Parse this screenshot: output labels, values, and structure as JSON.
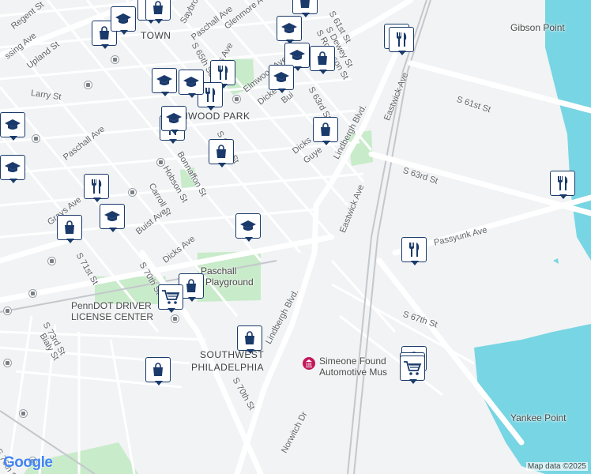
{
  "map": {
    "colors": {
      "background": "#f1f3f4",
      "water": "#78d5e3",
      "park": "#c8ebc9",
      "road": "#ffffff",
      "rail": "#c4c7cc",
      "marker": "#1a3a6b",
      "poi": "#c2185b"
    },
    "neighborhoods": [
      "TOWN",
      "ELMWOOD PARK",
      "SOUTHWEST",
      "PHILADELPHIA"
    ],
    "places": [
      "Gibson Point",
      "Yankee Point",
      "Paschall",
      "Playground",
      "PennDOT DRIVER",
      "LICENSE CENTER",
      "Simeone Found",
      "Automotive Mus"
    ],
    "streets": [
      "Regent St",
      "Saybrook",
      "Paschall Ave",
      "Glenmore Ave",
      "S 61st St",
      "S Dewey St",
      "S Robinson St",
      "ssing Ave",
      "Upland St",
      "Grays Ave",
      "S 65th St",
      "Larry St",
      "Elmwood Ave",
      "Dicke",
      "Bui",
      "S 63rd St",
      "Lindbergh Blvd.",
      "Eastwick Ave",
      "S 61st St",
      "Paschall Ave",
      "S 66th St",
      "Dicks",
      "Guye",
      "Bonnaffon St",
      "Hobson St",
      "S 63rd St",
      "Grays Ave",
      "Carroll St",
      "Buist Ave",
      "Eastwick Ave",
      "Passyunk Ave",
      "Dicks Ave",
      "S 71st St",
      "S 70th St",
      "Lindbergh Blvd.",
      "S 67th St",
      "S 73rd St",
      "Bialy St",
      "S 70th St",
      "Norwitch Dr",
      "S 76th St"
    ],
    "markers": [
      "shopping",
      "education",
      "restaurant",
      "shopping",
      "education",
      "education",
      "shopping",
      "restaurant",
      "education",
      "education",
      "restaurant",
      "restaurant",
      "education",
      "education",
      "restaurant",
      "shopping",
      "education",
      "education",
      "shopping",
      "restaurant",
      "education",
      "restaurant",
      "shopping",
      "education",
      "education",
      "restaurant",
      "shopping",
      "grocery",
      "shopping",
      "shopping",
      "shopping",
      "grocery",
      "grocery",
      "shopping"
    ],
    "poi_icon": "museum-icon",
    "attribution": "Map data ©2025",
    "logo": "Google"
  }
}
